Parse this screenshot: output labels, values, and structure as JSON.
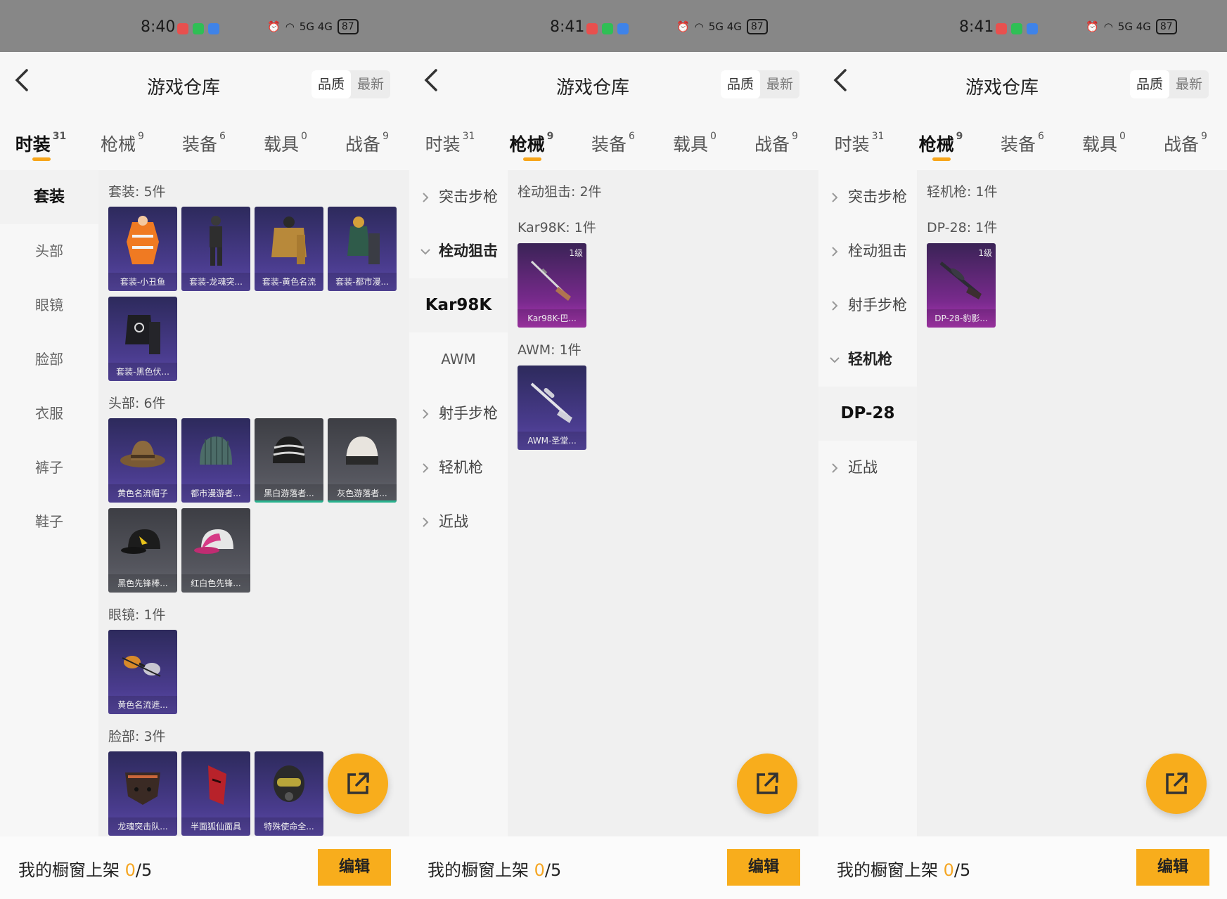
{
  "screens": [
    {
      "status": {
        "time": "8:40",
        "signal": "5G  4G",
        "battery": "87"
      },
      "header": {
        "title": "游戏仓库",
        "sort_quality": "品质",
        "sort_latest": "最新"
      },
      "tabs": [
        {
          "label": "时装",
          "count": "31"
        },
        {
          "label": "枪械",
          "count": "9"
        },
        {
          "label": "装备",
          "count": "6"
        },
        {
          "label": "载具",
          "count": "0"
        },
        {
          "label": "战备",
          "count": "9"
        }
      ],
      "sidebar": [
        "套装",
        "头部",
        "眼镜",
        "脸部",
        "衣服",
        "裤子",
        "鞋子"
      ],
      "sections": [
        {
          "title": "套装: 5件",
          "items": [
            "套装-小丑鱼",
            "套装-龙魂突...",
            "套装-黄色名流",
            "套装-都市漫...",
            "套装-黑色伏..."
          ]
        },
        {
          "title": "头部: 6件",
          "items": [
            "黄色名流帽子",
            "都市漫游者...",
            "黑白游落者...",
            "灰色游落者...",
            "黑色先锋棒...",
            "红白色先锋..."
          ]
        },
        {
          "title": "眼镜: 1件",
          "items": [
            "黄色名流遮..."
          ]
        },
        {
          "title": "脸部: 3件",
          "items": [
            "龙魂突击队...",
            "半面狐仙面具",
            "特殊使命全..."
          ]
        }
      ],
      "bottom": {
        "label": "我的橱窗上架",
        "count": "0",
        "total": "/5",
        "edit": "编辑"
      }
    },
    {
      "status": {
        "time": "8:41",
        "signal": "5G  4G",
        "battery": "87"
      },
      "header": {
        "title": "游戏仓库",
        "sort_quality": "品质",
        "sort_latest": "最新"
      },
      "tabs": [
        {
          "label": "时装",
          "count": "31"
        },
        {
          "label": "枪械",
          "count": "9"
        },
        {
          "label": "装备",
          "count": "6"
        },
        {
          "label": "载具",
          "count": "0"
        },
        {
          "label": "战备",
          "count": "9"
        }
      ],
      "sidebar": {
        "g1": "突击步枪",
        "g2": "栓动狙击",
        "s1": "Kar98K",
        "s2": "AWM",
        "g3": "射手步枪",
        "g4": "轻机枪",
        "g5": "近战"
      },
      "sections": [
        {
          "title": "栓动狙击: 2件"
        },
        {
          "title": "Kar98K: 1件",
          "item": "Kar98K-巴...",
          "level": "1级"
        },
        {
          "title": "AWM: 1件",
          "item": "AWM-圣堂..."
        }
      ],
      "bottom": {
        "label": "我的橱窗上架",
        "count": "0",
        "total": "/5",
        "edit": "编辑"
      }
    },
    {
      "status": {
        "time": "8:41",
        "signal": "5G  4G",
        "battery": "87"
      },
      "header": {
        "title": "游戏仓库",
        "sort_quality": "品质",
        "sort_latest": "最新"
      },
      "tabs": [
        {
          "label": "时装",
          "count": "31"
        },
        {
          "label": "枪械",
          "count": "9"
        },
        {
          "label": "装备",
          "count": "6"
        },
        {
          "label": "载具",
          "count": "0"
        },
        {
          "label": "战备",
          "count": "9"
        }
      ],
      "sidebar": {
        "g1": "突击步枪",
        "g2": "栓动狙击",
        "g3": "射手步枪",
        "g4": "轻机枪",
        "s1": "DP-28",
        "g5": "近战"
      },
      "sections": [
        {
          "title": "轻机枪: 1件"
        },
        {
          "title": "DP-28: 1件",
          "item": "DP-28-豹影...",
          "level": "1级"
        }
      ],
      "bottom": {
        "label": "我的橱窗上架",
        "count": "0",
        "total": "/5",
        "edit": "编辑"
      }
    }
  ],
  "colors": {
    "accent": "#f8ad1c",
    "purple_item": "#4a3c8e",
    "magenta_item": "#b23ab8",
    "gray_item": "#55565e"
  }
}
